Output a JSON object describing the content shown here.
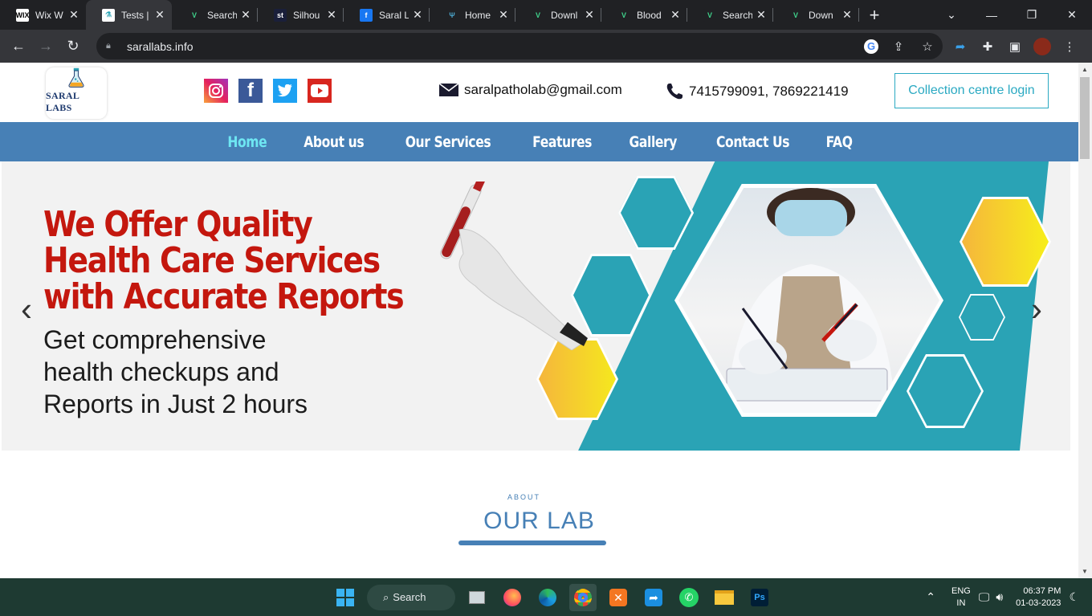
{
  "browser": {
    "tabs": [
      {
        "title": "Wix W",
        "icon": "wix-icon",
        "fav_bg": "#ffffff",
        "fav_fg": "#000000",
        "fav_text": "WIX"
      },
      {
        "title": "Tests |",
        "icon": "saral-icon",
        "fav_bg": "#ffffff",
        "fav_fg": "#2aa3b5",
        "fav_text": "⚗"
      },
      {
        "title": "Search",
        "icon": "vectorstock-icon",
        "fav_bg": "#202124",
        "fav_fg": "#3fd08a",
        "fav_text": "V"
      },
      {
        "title": "Silhou",
        "icon": "silhouette-icon",
        "fav_bg": "#1a1f3a",
        "fav_fg": "#ffffff",
        "fav_text": "st"
      },
      {
        "title": "Saral L",
        "icon": "facebook-icon",
        "fav_bg": "#1877f2",
        "fav_fg": "#ffffff",
        "fav_text": "f"
      },
      {
        "title": "Home",
        "icon": "wing-icon",
        "fav_bg": "#202124",
        "fav_fg": "#4aa3c8",
        "fav_text": "Ψ"
      },
      {
        "title": "Downl",
        "icon": "vectorstock-icon",
        "fav_bg": "#202124",
        "fav_fg": "#3fd08a",
        "fav_text": "V"
      },
      {
        "title": "Blood",
        "icon": "vectorstock-icon",
        "fav_bg": "#202124",
        "fav_fg": "#3fd08a",
        "fav_text": "V"
      },
      {
        "title": "Search",
        "icon": "vectorstock-icon",
        "fav_bg": "#202124",
        "fav_fg": "#3fd08a",
        "fav_text": "V"
      },
      {
        "title": "Down",
        "icon": "vectorstock-icon",
        "fav_bg": "#202124",
        "fav_fg": "#3fd08a",
        "fav_text": "V"
      }
    ],
    "url": "sarallabs.info"
  },
  "site": {
    "logo_text": "SARAL LABS",
    "email": "saralpatholab@gmail.com",
    "phone": "7415799091, 7869221419",
    "cc_login": "Collection centre login",
    "nav": [
      {
        "label": "Home",
        "current": true
      },
      {
        "label": "About us",
        "current": false
      },
      {
        "label": "Our Services",
        "current": false
      },
      {
        "label": "Features",
        "current": false
      },
      {
        "label": "Gallery",
        "current": false
      },
      {
        "label": "Contact Us",
        "current": false
      },
      {
        "label": "FAQ",
        "current": false
      }
    ],
    "hero": {
      "headline_1": "We Offer Quality",
      "headline_2": "Health Care Services",
      "headline_3": "with Accurate Reports",
      "sub_1": "Get comprehensive",
      "sub_2": "health checkups and",
      "sub_3": "Reports in Just 2 hours"
    },
    "section_small": "ABOUT",
    "section_title": "OUR LAB"
  },
  "taskbar": {
    "search_label": "Search",
    "lang": "ENG",
    "region": "IN",
    "time": "06:37 PM",
    "date": "01-03-2023"
  },
  "colors": {
    "nav_bg": "#4780b6",
    "nav_current": "#6ee6f2",
    "headline_red": "#c4170e",
    "teal": "#2aa3b5",
    "hex_yellow": "#f7c842"
  }
}
